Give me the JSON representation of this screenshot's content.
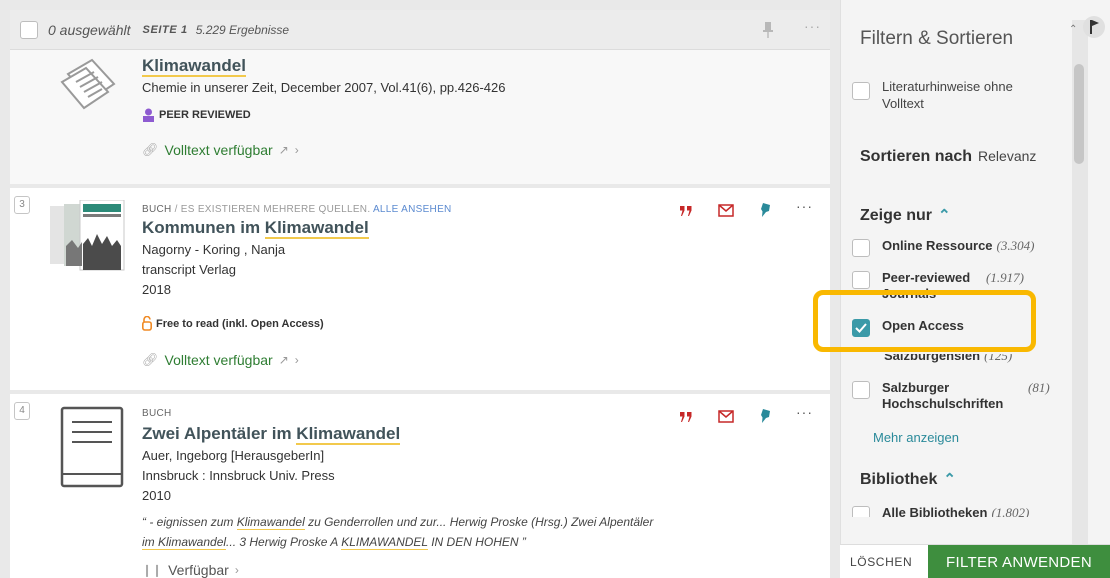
{
  "topbar": {
    "selected": "0 ausgewählt",
    "page_label": "SEITE 1",
    "result_count": "5.229 Ergebnisse",
    "more": "···"
  },
  "results": [
    {
      "title_main": "Klimawandel",
      "meta": [
        "Chemie in unserer Zeit, December 2007, Vol.41(6), pp.426-426"
      ],
      "badge": "PEER REVIEWED",
      "availability": "Volltext verfügbar"
    },
    {
      "number": "3",
      "type": "BUCH",
      "type_extra": "/ ES EXISTIEREN MEHRERE QUELLEN.",
      "type_link": "ALLE ANSEHEN",
      "title_pre": "Kommunen im ",
      "title_hl": "Klimawandel",
      "meta": [
        "Nagorny - Koring , Nanja",
        "transcript Verlag",
        "2018"
      ],
      "badge": "Free to read (inkl. Open Access)",
      "availability": "Volltext verfügbar",
      "more": "···"
    },
    {
      "number": "4",
      "type": "BUCH",
      "title_pre": "Zwei Alpentäler im ",
      "title_hl": "Klimawandel",
      "meta": [
        "Auer, Ingeborg [HerausgeberIn]",
        "Innsbruck : Innsbruck Univ. Press",
        "2010"
      ],
      "snippet_1_pre": "“ - eignissen zum ",
      "snippet_1_hl": "Klimawandel",
      "snippet_1_post": " zu Genderrollen und zur... Herwig Proske (Hrsg.) Zwei Alpentäler",
      "snippet_2_hl1": "im Klimawandel",
      "snippet_2_mid": "... 3 Herwig Proske A ",
      "snippet_2_hl2": "KLIMAWANDEL",
      "snippet_2_post": " IN DEN HOHEN ”",
      "availability": "Verfügbar",
      "more": "···"
    }
  ],
  "sidebar": {
    "title": "Filtern & Sortieren",
    "lit_filter": "Literaturhinweise ohne Volltext",
    "sort_label": "Sortieren nach",
    "sort_value": "Relevanz",
    "show_only": "Zeige nur",
    "filters": [
      {
        "label": "Online Ressource",
        "count": "(3.304)"
      },
      {
        "label": "Peer-reviewed",
        "label2": "Journals",
        "count": "(1.917)"
      },
      {
        "label": "Open Access",
        "checked": true
      },
      {
        "label": "Salzburgensien",
        "count": "(125)"
      },
      {
        "label": "Salzburger",
        "label2": "Hochschulschriften",
        "count": "(81)"
      }
    ],
    "more_link": "Mehr anzeigen",
    "library_head": "Bibliothek",
    "library_item": "Alle Bibliotheken",
    "library_count": "(1.802)",
    "clear": "LÖSCHEN",
    "apply": "FILTER ANWENDEN"
  },
  "colors": {
    "accent": "#3b9aa8",
    "highlight": "#f9b800",
    "apply_button": "#3e8e3e",
    "cite_red": "#c62828",
    "pin_teal": "#2a8a9a",
    "link_green": "#2e7d32"
  }
}
